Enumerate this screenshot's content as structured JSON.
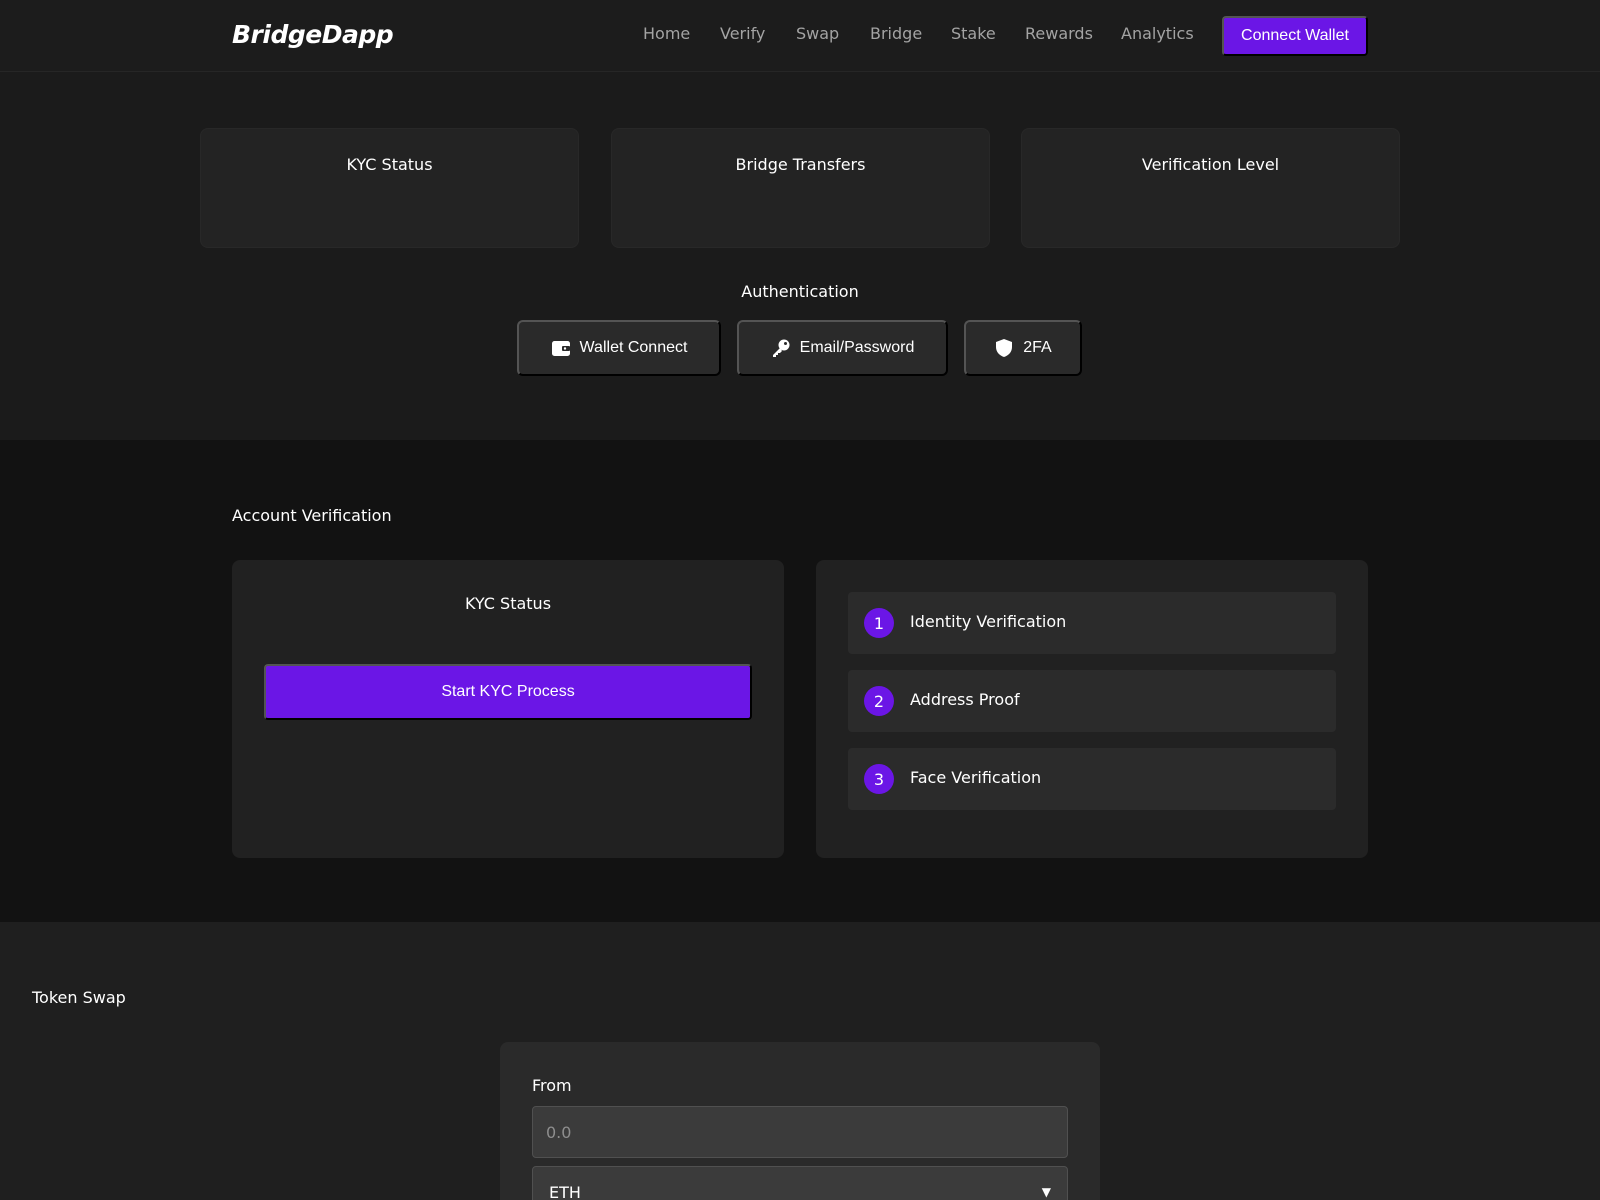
{
  "app": {
    "logo": "BridgeDapp"
  },
  "nav": {
    "links": [
      "Home",
      "Verify",
      "Swap",
      "Bridge",
      "Stake",
      "Rewards",
      "Analytics"
    ],
    "connect_wallet": "Connect Wallet"
  },
  "stats": {
    "cards": [
      "KYC Status",
      "Bridge Transfers",
      "Verification Level"
    ]
  },
  "auth": {
    "title": "Authentication",
    "options": [
      {
        "label": "Wallet Connect",
        "icon": "wallet-icon"
      },
      {
        "label": "Email/Password",
        "icon": "key-icon"
      },
      {
        "label": "2FA",
        "icon": "shield-icon"
      }
    ]
  },
  "verification": {
    "title": "Account Verification",
    "kyc_title": "KYC Status",
    "kyc_button": "Start KYC Process",
    "steps": [
      {
        "num": "1",
        "label": "Identity Verification"
      },
      {
        "num": "2",
        "label": "Address Proof"
      },
      {
        "num": "3",
        "label": "Face Verification"
      }
    ]
  },
  "swap": {
    "title": "Token Swap",
    "from_label": "From",
    "amount_placeholder": "0.0",
    "token": "ETH"
  },
  "colors": {
    "accent": "#6b16e6",
    "background": "#1f1f1f",
    "card": "#232323"
  }
}
